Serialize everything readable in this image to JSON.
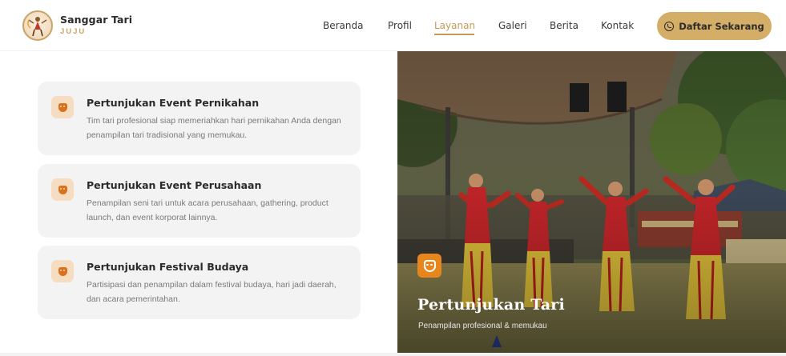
{
  "brand": {
    "name": "Sanggar Tari",
    "sub": "JUJU"
  },
  "nav": [
    {
      "label": "Beranda"
    },
    {
      "label": "Profil"
    },
    {
      "label": "Layanan",
      "active": true
    },
    {
      "label": "Galeri"
    },
    {
      "label": "Berita"
    },
    {
      "label": "Kontak"
    }
  ],
  "cta": {
    "label": "Daftar Sekarang",
    "icon": "whatsapp-icon"
  },
  "services": [
    {
      "title": "Pertunjukan Event Pernikahan",
      "desc": "Tim tari profesional siap memeriahkan hari pernikahan Anda dengan penampilan tari tradisional yang memukau.",
      "icon": "theater-mask-icon"
    },
    {
      "title": "Pertunjukan Event Perusahaan",
      "desc": "Penampilan seni tari untuk acara perusahaan, gathering, product launch, dan event korporat lainnya.",
      "icon": "theater-mask-icon"
    },
    {
      "title": "Pertunjukan Festival Budaya",
      "desc": "Partisipasi dan penampilan dalam festival budaya, hari jadi daerah, dan acara pemerintahan.",
      "icon": "theater-mask-icon"
    }
  ],
  "hero": {
    "title": "Pertunjukan Tari",
    "subtitle": "Penampilan profesional & memukau",
    "icon": "theater-mask-icon"
  },
  "colors": {
    "accent": "#c49a56",
    "cta_bg": "#d4ad67",
    "icon_orange": "#e8861e"
  }
}
